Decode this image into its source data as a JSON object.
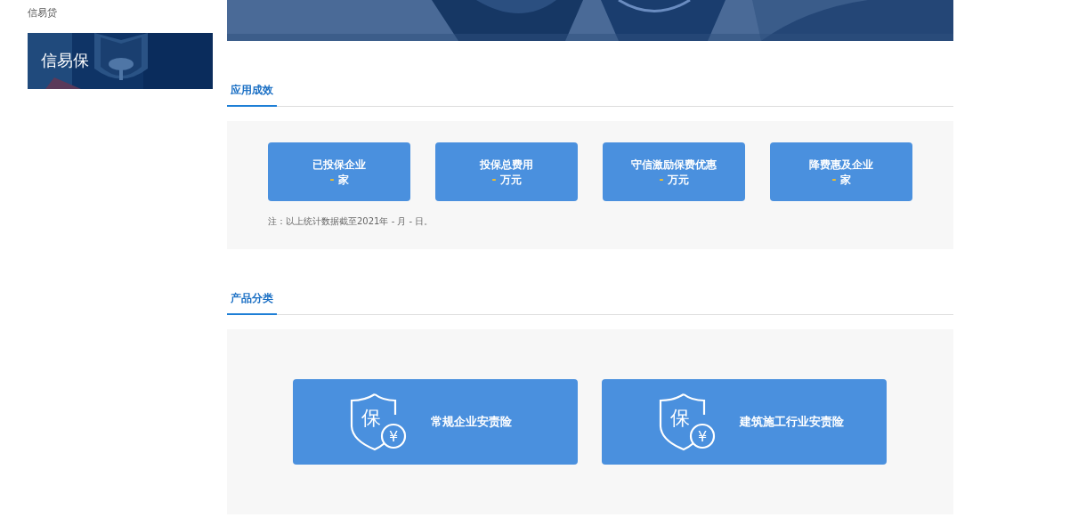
{
  "sidebar": {
    "items": [
      {
        "kind": "link",
        "label": "信易贷"
      },
      {
        "kind": "banner",
        "label": "信易保"
      }
    ]
  },
  "effects": {
    "title": "应用成效",
    "stats": [
      {
        "label": "已投保企业",
        "value": "-",
        "unit": "家"
      },
      {
        "label": "投保总费用",
        "value": "-",
        "unit": "万元"
      },
      {
        "label": "守信激励保费优惠",
        "value": "-",
        "unit": "万元"
      },
      {
        "label": "降费惠及企业",
        "value": "-",
        "unit": "家"
      }
    ],
    "note": "注：以上统计数据截至2021年 - 月 - 日。"
  },
  "products": {
    "title": "产品分类",
    "items": [
      {
        "label": "常规企业安责险",
        "icon_glyph": "保",
        "currency_glyph": "¥"
      },
      {
        "label": "建筑施工行业安责险",
        "icon_glyph": "保",
        "currency_glyph": "¥"
      }
    ]
  }
}
